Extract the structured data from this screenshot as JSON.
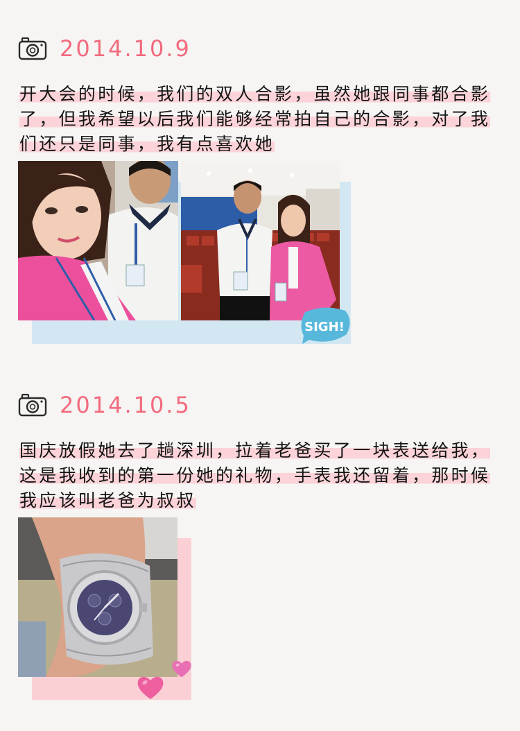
{
  "entries": [
    {
      "date": "2014.10.9",
      "text": "开大会的时候，我们的双人合影，虽然她跟同事都合影了，但我希望以后我们能够经常拍自己的合影，对了我们还只是同事，我有点喜欢她",
      "sticker": "SIGH!",
      "photo_icons": [
        "selfie-photo",
        "conference-photo"
      ]
    },
    {
      "date": "2014.10.5",
      "text": "国庆放假她去了趟深圳，拉着老爸买了一块表送给我，这是我收到的第一份她的礼物，手表我还留着，那时候我应该叫老爸为叔叔",
      "photo_icons": [
        "wristwatch-photo"
      ],
      "stickers": [
        "heart-icon",
        "heart-icon"
      ]
    }
  ],
  "colors": {
    "background": "#f6f5f3",
    "date_pink": "#f26a7e",
    "highlight_pink": "#fbd3d8",
    "shadow_blue": "#d3e7f3",
    "shadow_pink": "#fbd0d4",
    "sticker_blue": "#58b8dc",
    "heart_pink": "#ee5fa0"
  }
}
